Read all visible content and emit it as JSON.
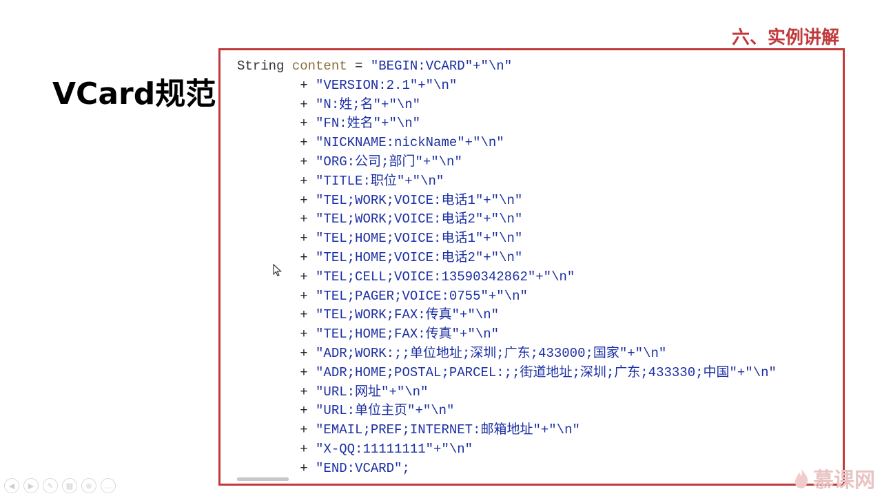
{
  "section_title": "六、实例讲解",
  "slide_title": "VCard规范",
  "code": {
    "first_line": {
      "type": "String",
      "var": "content",
      "op": " = ",
      "str": "\"BEGIN:VCARD\"+\"\\n\""
    },
    "continuation_prefix": "        + ",
    "lines": [
      "\"VERSION:2.1\"+\"\\n\"",
      "\"N:姓;名\"+\"\\n\"",
      "\"FN:姓名\"+\"\\n\"",
      "\"NICKNAME:nickName\"+\"\\n\"",
      "\"ORG:公司;部门\"+\"\\n\"",
      "\"TITLE:职位\"+\"\\n\"",
      "\"TEL;WORK;VOICE:电话1\"+\"\\n\"",
      "\"TEL;WORK;VOICE:电话2\"+\"\\n\"",
      "\"TEL;HOME;VOICE:电话1\"+\"\\n\"",
      "\"TEL;HOME;VOICE:电话2\"+\"\\n\"",
      "\"TEL;CELL;VOICE:13590342862\"+\"\\n\"",
      "\"TEL;PAGER;VOICE:0755\"+\"\\n\"",
      "\"TEL;WORK;FAX:传真\"+\"\\n\"",
      "\"TEL;HOME;FAX:传真\"+\"\\n\"",
      "\"ADR;WORK:;;单位地址;深圳;广东;433000;国家\"+\"\\n\"",
      "\"ADR;HOME;POSTAL;PARCEL:;;街道地址;深圳;广东;433330;中国\"+\"\\n\"",
      "\"URL:网址\"+\"\\n\"",
      "\"URL:单位主页\"+\"\\n\"",
      "\"EMAIL;PREF;INTERNET:邮箱地址\"+\"\\n\"",
      "\"X-QQ:11111111\"+\"\\n\"",
      "\"END:VCARD\";"
    ]
  },
  "controls": [
    {
      "name": "prev-icon",
      "glyph": "◀"
    },
    {
      "name": "next-icon",
      "glyph": "▶"
    },
    {
      "name": "pen-icon",
      "glyph": "✎"
    },
    {
      "name": "slides-icon",
      "glyph": "▦"
    },
    {
      "name": "zoom-icon",
      "glyph": "⊕"
    },
    {
      "name": "more-icon",
      "glyph": "…"
    }
  ],
  "brand": "慕课网",
  "colors": {
    "accent": "#c0393b",
    "string": "#1b2fa3",
    "variable": "#8a6d3b"
  }
}
